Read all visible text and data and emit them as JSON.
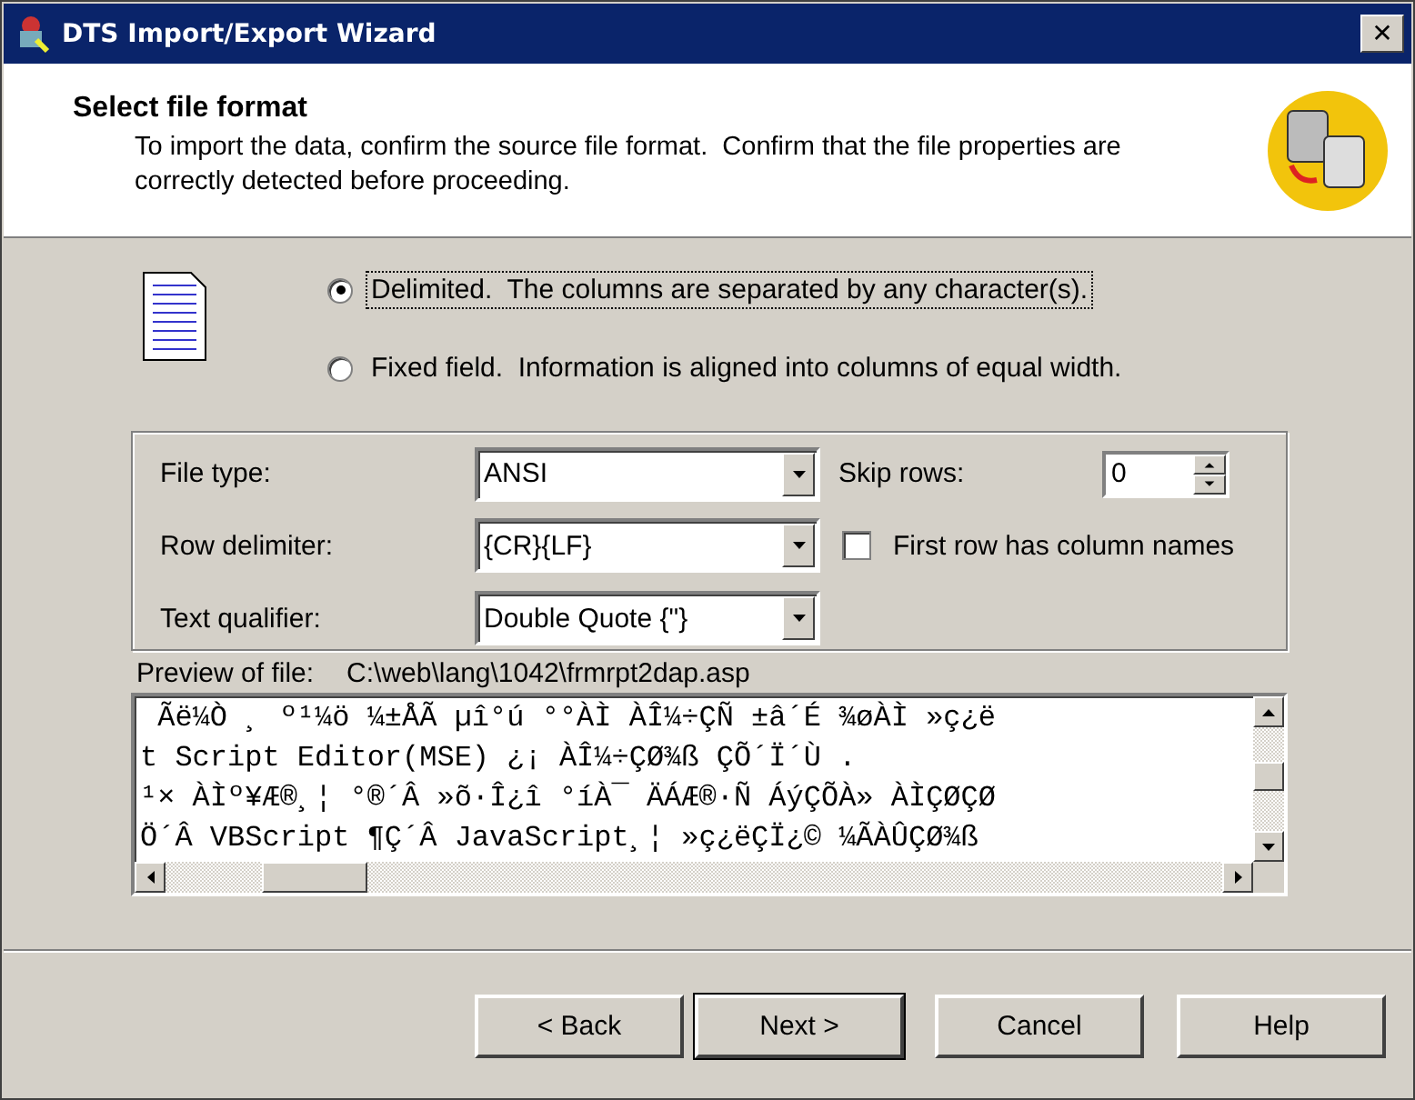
{
  "window": {
    "title": "DTS Import/Export Wizard",
    "close": "✕"
  },
  "header": {
    "title": "Select file format",
    "description": "To import the data, confirm the source file format.  Confirm that the file properties are correctly detected before proceeding."
  },
  "format_options": [
    {
      "label": "Delimited.  The columns are separated by any character(s).",
      "selected": true
    },
    {
      "label": "Fixed field.  Information is aligned into columns of equal width.",
      "selected": false
    }
  ],
  "properties": {
    "file_type": {
      "label": "File type:",
      "value": "ANSI"
    },
    "row_delimiter": {
      "label": "Row delimiter:",
      "value": "{CR}{LF}"
    },
    "text_qualifier": {
      "label": "Text qualifier:",
      "value": "Double Quote {\"}"
    },
    "skip_rows": {
      "label": "Skip rows:",
      "value": "0"
    },
    "first_row_names": {
      "label": "First row has column names",
      "checked": false
    }
  },
  "preview": {
    "label": "Preview of file:",
    "path": "C:\\web\\lang\\1042\\frmrpt2dap.asp",
    "lines": [
      " Ãë¼Ò ¸ º¹¼ö ¼±ÅÃ µî°ú °°ÀÌ ÀÎ¼÷ÇÑ ±â´É ¾øÀÌ »ç¿ë",
      "t Script Editor(MSE) ¿¡ ÀÎ¼÷ÇØ¾ß ÇÕ´Ï´Ù .",
      "¹× ÀÌº¥Æ®¸¦ °®´Â »õ·Î¿î °íÀ¯ ÄÁÆ®·Ñ ÁýÇÕÀ» ÀÌÇØÇØ",
      "Ö´Â VBScript ¶Ç´Â JavaScript¸¦ »ç¿ëÇÏ¿© ¼ÃÀÛÇØ¾ß"
    ]
  },
  "buttons": [
    {
      "label": "< Back",
      "default": false
    },
    {
      "label": "Next >",
      "default": true
    },
    {
      "label": "Cancel",
      "default": false
    },
    {
      "label": "Help",
      "default": false
    }
  ]
}
